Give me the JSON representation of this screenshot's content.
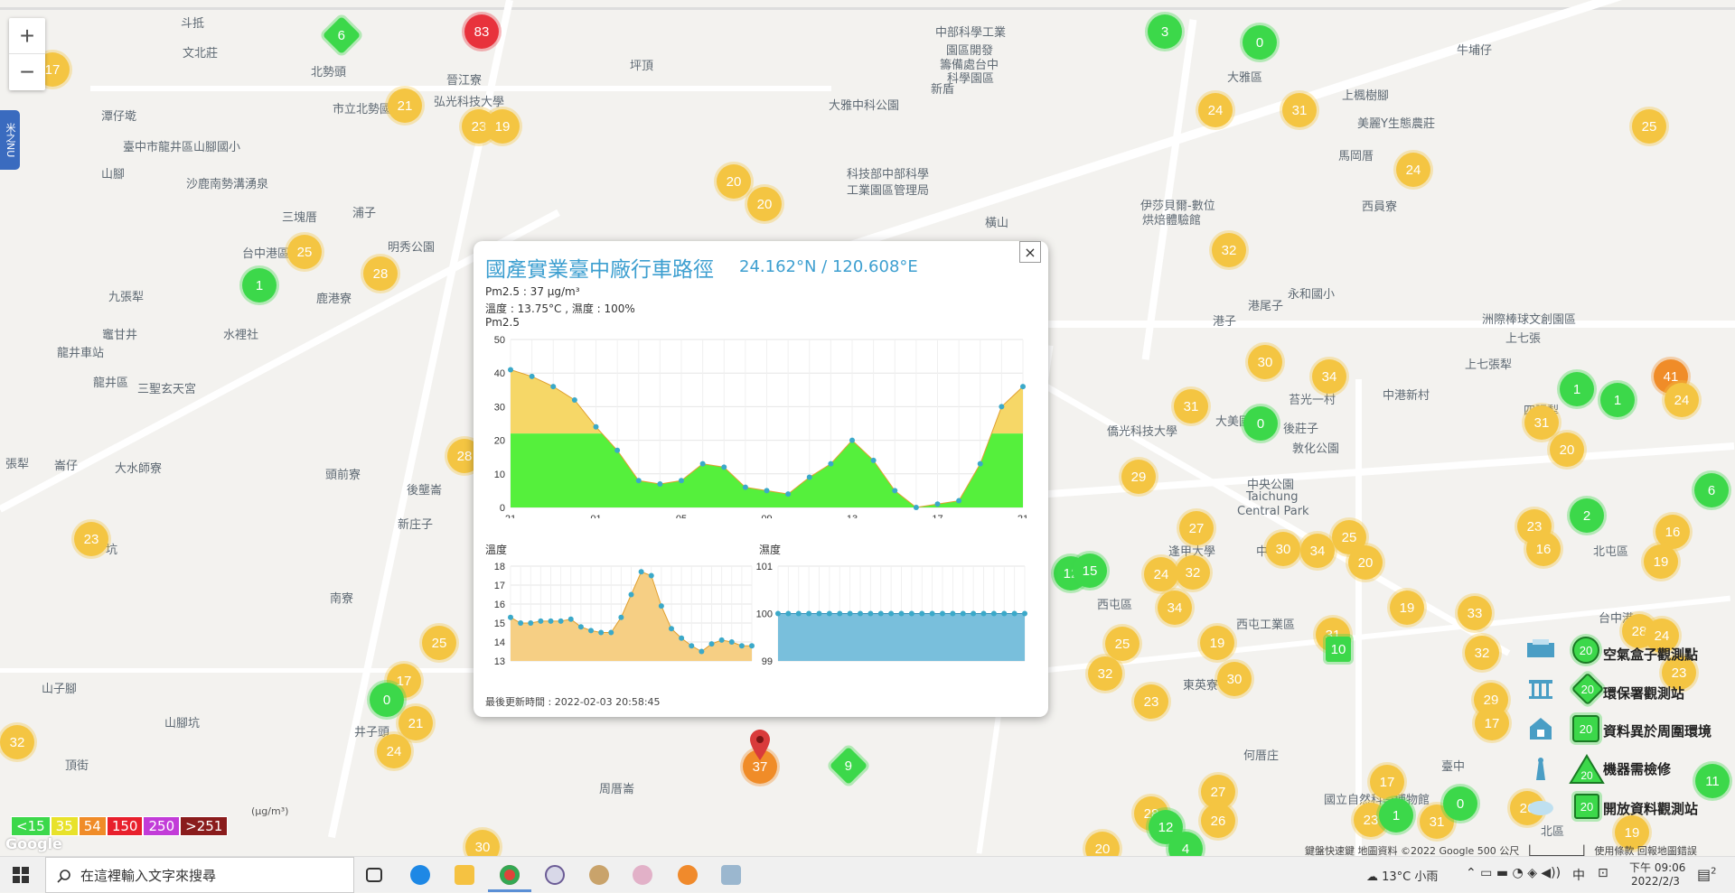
{
  "map": {
    "place_labels": [
      {
        "t": "斗抵",
        "x": 200,
        "y": 15
      },
      {
        "t": "文北莊",
        "x": 202,
        "y": 48
      },
      {
        "t": "北勢頭",
        "x": 344,
        "y": 69
      },
      {
        "t": "晉江寮",
        "x": 494,
        "y": 78
      },
      {
        "t": "弘光科技大學",
        "x": 480,
        "y": 102
      },
      {
        "t": "市立北勢國小",
        "x": 368,
        "y": 110
      },
      {
        "t": "潭仔墘",
        "x": 112,
        "y": 118
      },
      {
        "t": "臺中市龍井區山腳國小",
        "x": 136,
        "y": 152
      },
      {
        "t": "山腳",
        "x": 112,
        "y": 182
      },
      {
        "t": "沙鹿南勢溝湧泉",
        "x": 206,
        "y": 193
      },
      {
        "t": "三塊厝",
        "x": 312,
        "y": 230
      },
      {
        "t": "浦子",
        "x": 390,
        "y": 225
      },
      {
        "t": "明秀公園",
        "x": 429,
        "y": 263
      },
      {
        "t": "台中港區",
        "x": 268,
        "y": 270
      },
      {
        "t": "鹿港寮",
        "x": 350,
        "y": 320
      },
      {
        "t": "九張犁",
        "x": 120,
        "y": 318
      },
      {
        "t": "水裡社",
        "x": 247,
        "y": 360
      },
      {
        "t": "竈甘井",
        "x": 113,
        "y": 360
      },
      {
        "t": "龍井車站",
        "x": 63,
        "y": 380
      },
      {
        "t": "三聖玄天宮",
        "x": 152,
        "y": 420
      },
      {
        "t": "龍井區",
        "x": 103,
        "y": 413
      },
      {
        "t": "張犁",
        "x": 6,
        "y": 503
      },
      {
        "t": "崙仔",
        "x": 60,
        "y": 505
      },
      {
        "t": "大水師寮",
        "x": 127,
        "y": 508
      },
      {
        "t": "頭前寮",
        "x": 360,
        "y": 515
      },
      {
        "t": "後壟崙",
        "x": 450,
        "y": 532
      },
      {
        "t": "新庄子",
        "x": 440,
        "y": 570
      },
      {
        "t": "溪",
        "x": 95,
        "y": 582
      },
      {
        "t": "坑",
        "x": 117,
        "y": 598
      },
      {
        "t": "南寮",
        "x": 365,
        "y": 652
      },
      {
        "t": "山子腳",
        "x": 46,
        "y": 752
      },
      {
        "t": "山腳坑",
        "x": 182,
        "y": 790
      },
      {
        "t": "井子頭",
        "x": 392,
        "y": 800
      },
      {
        "t": "頂街",
        "x": 72,
        "y": 837
      },
      {
        "t": "周厝崙",
        "x": 663,
        "y": 863
      },
      {
        "t": "坪頂",
        "x": 697,
        "y": 62
      },
      {
        "t": "新盾",
        "x": 1030,
        "y": 88
      },
      {
        "t": "大雅中科公園",
        "x": 917,
        "y": 106
      },
      {
        "t": "科技部中部科學",
        "x": 937,
        "y": 182
      },
      {
        "t": "工業園區管理局",
        "x": 937,
        "y": 200
      },
      {
        "t": "中部科學工業",
        "x": 1035,
        "y": 25
      },
      {
        "t": "園區開發",
        "x": 1047,
        "y": 45
      },
      {
        "t": "籌備處台中",
        "x": 1040,
        "y": 61
      },
      {
        "t": "科學園區",
        "x": 1048,
        "y": 76
      },
      {
        "t": "橫山",
        "x": 1090,
        "y": 236
      },
      {
        "t": "伊莎貝爾-數位",
        "x": 1262,
        "y": 217
      },
      {
        "t": "烘焙體驗館",
        "x": 1264,
        "y": 233
      },
      {
        "t": "大雅區",
        "x": 1358,
        "y": 75
      },
      {
        "t": "上楓樹腳",
        "x": 1485,
        "y": 95
      },
      {
        "t": "牛埔仔",
        "x": 1612,
        "y": 45
      },
      {
        "t": "美麗Y生態農莊",
        "x": 1502,
        "y": 126
      },
      {
        "t": "馬岡厝",
        "x": 1481,
        "y": 162
      },
      {
        "t": "西員寮",
        "x": 1507,
        "y": 218
      },
      {
        "t": "永和國小",
        "x": 1425,
        "y": 315
      },
      {
        "t": "港尾子",
        "x": 1381,
        "y": 328
      },
      {
        "t": "港子",
        "x": 1342,
        "y": 345
      },
      {
        "t": "上七張",
        "x": 1666,
        "y": 364
      },
      {
        "t": "上七張犁",
        "x": 1621,
        "y": 393
      },
      {
        "t": "洲際棒球文創園區",
        "x": 1640,
        "y": 343
      },
      {
        "t": "中港新村",
        "x": 1530,
        "y": 427
      },
      {
        "t": "四張犁",
        "x": 1686,
        "y": 444
      },
      {
        "t": "苔光一村",
        "x": 1426,
        "y": 432
      },
      {
        "t": "僑光科技大學",
        "x": 1225,
        "y": 467
      },
      {
        "t": "大美國小",
        "x": 1345,
        "y": 456
      },
      {
        "t": "後莊子",
        "x": 1420,
        "y": 464
      },
      {
        "t": "敦化公園",
        "x": 1430,
        "y": 486
      },
      {
        "t": "中央公園",
        "x": 1380,
        "y": 526
      },
      {
        "t": "Taichung",
        "x": 1379,
        "y": 543
      },
      {
        "t": "Central Park",
        "x": 1369,
        "y": 559
      },
      {
        "t": "逢甲大學",
        "x": 1293,
        "y": 600
      },
      {
        "t": "西屯區",
        "x": 1214,
        "y": 659
      },
      {
        "t": "西屯工業區",
        "x": 1368,
        "y": 681
      },
      {
        "t": "東英寮",
        "x": 1309,
        "y": 748
      },
      {
        "t": "中科",
        "x": 1390,
        "y": 600
      },
      {
        "t": "北屯區",
        "x": 1763,
        "y": 600
      },
      {
        "t": "台中港",
        "x": 1769,
        "y": 674
      },
      {
        "t": "臺中",
        "x": 1595,
        "y": 838
      },
      {
        "t": "何厝庄",
        "x": 1376,
        "y": 826
      },
      {
        "t": "國立自然科學博物館",
        "x": 1465,
        "y": 875
      },
      {
        "t": "北區",
        "x": 1705,
        "y": 910
      }
    ]
  },
  "zoom": {
    "in": "+",
    "out": "−"
  },
  "side_tab": {
    "label": "米之NU"
  },
  "markers": [
    {
      "v": "6",
      "c": "g",
      "s": "dia",
      "x": 378,
      "y": 39
    },
    {
      "v": "83",
      "c": "r",
      "x": 533,
      "y": 35
    },
    {
      "v": "17",
      "c": "y",
      "x": 58,
      "y": 77
    },
    {
      "v": "21",
      "c": "y",
      "x": 448,
      "y": 117
    },
    {
      "v": "23",
      "c": "y",
      "x": 530,
      "y": 140
    },
    {
      "v": "19",
      "c": "y",
      "x": 556,
      "y": 140
    },
    {
      "v": "1",
      "c": "g",
      "x": 287,
      "y": 316
    },
    {
      "v": "25",
      "c": "y",
      "x": 337,
      "y": 279
    },
    {
      "v": "28",
      "c": "y",
      "x": 421,
      "y": 303
    },
    {
      "v": "20",
      "c": "y",
      "x": 812,
      "y": 201
    },
    {
      "v": "20",
      "c": "y",
      "x": 846,
      "y": 226
    },
    {
      "v": "28",
      "c": "y",
      "x": 514,
      "y": 505
    },
    {
      "v": "23",
      "c": "y",
      "x": 101,
      "y": 597
    },
    {
      "v": "25",
      "c": "y",
      "x": 486,
      "y": 712
    },
    {
      "v": "17",
      "c": "y",
      "x": 447,
      "y": 754
    },
    {
      "v": "0",
      "c": "g",
      "x": 428,
      "y": 775
    },
    {
      "v": "21",
      "c": "y",
      "x": 460,
      "y": 801
    },
    {
      "v": "24",
      "c": "y",
      "x": 436,
      "y": 832
    },
    {
      "v": "32",
      "c": "y",
      "x": 19,
      "y": 822
    },
    {
      "v": "30",
      "c": "y",
      "x": 534,
      "y": 938
    },
    {
      "v": "9",
      "c": "g",
      "s": "dia",
      "x": 939,
      "y": 848
    },
    {
      "v": "3",
      "c": "g",
      "x": 1289,
      "y": 35
    },
    {
      "v": "0",
      "c": "g",
      "x": 1394,
      "y": 47
    },
    {
      "v": "24",
      "c": "y",
      "x": 1345,
      "y": 122
    },
    {
      "v": "31",
      "c": "y",
      "x": 1438,
      "y": 122
    },
    {
      "v": "25",
      "c": "y",
      "x": 1825,
      "y": 140
    },
    {
      "v": "24",
      "c": "y",
      "x": 1564,
      "y": 188
    },
    {
      "v": "32",
      "c": "y",
      "x": 1360,
      "y": 277
    },
    {
      "v": "30",
      "c": "y",
      "x": 1400,
      "y": 401
    },
    {
      "v": "34",
      "c": "y",
      "x": 1471,
      "y": 417
    },
    {
      "v": "31",
      "c": "y",
      "x": 1318,
      "y": 450
    },
    {
      "v": "0",
      "c": "g",
      "x": 1395,
      "y": 469
    },
    {
      "v": "29",
      "c": "y",
      "x": 1260,
      "y": 528
    },
    {
      "v": "27",
      "c": "y",
      "x": 1324,
      "y": 585
    },
    {
      "v": "30",
      "c": "y",
      "x": 1420,
      "y": 608
    },
    {
      "v": "34",
      "c": "y",
      "x": 1458,
      "y": 610
    },
    {
      "v": "25",
      "c": "y",
      "x": 1493,
      "y": 595
    },
    {
      "v": "20",
      "c": "y",
      "x": 1511,
      "y": 623
    },
    {
      "v": "12",
      "c": "g",
      "x": 1185,
      "y": 635
    },
    {
      "v": "15",
      "c": "g",
      "x": 1206,
      "y": 632
    },
    {
      "v": "24",
      "c": "y",
      "x": 1285,
      "y": 636
    },
    {
      "v": "32",
      "c": "y",
      "x": 1320,
      "y": 634
    },
    {
      "v": "34",
      "c": "y",
      "x": 1300,
      "y": 673
    },
    {
      "v": "19",
      "c": "y",
      "x": 1557,
      "y": 673
    },
    {
      "v": "33",
      "c": "y",
      "x": 1632,
      "y": 679
    },
    {
      "v": "31",
      "c": "y",
      "x": 1475,
      "y": 703
    },
    {
      "v": "10",
      "c": "g",
      "s": "sq",
      "x": 1481,
      "y": 719
    },
    {
      "v": "19",
      "c": "y",
      "x": 1347,
      "y": 712
    },
    {
      "v": "25",
      "c": "y",
      "x": 1242,
      "y": 713
    },
    {
      "v": "32",
      "c": "y",
      "x": 1223,
      "y": 746
    },
    {
      "v": "30",
      "c": "y",
      "x": 1366,
      "y": 752
    },
    {
      "v": "23",
      "c": "y",
      "x": 1274,
      "y": 777
    },
    {
      "v": "32",
      "c": "y",
      "x": 1640,
      "y": 723
    },
    {
      "v": "29",
      "c": "y",
      "x": 1650,
      "y": 775
    },
    {
      "v": "17",
      "c": "y",
      "x": 1651,
      "y": 801
    },
    {
      "v": "27",
      "c": "y",
      "x": 1348,
      "y": 877
    },
    {
      "v": "26",
      "c": "y",
      "x": 1348,
      "y": 909
    },
    {
      "v": "28",
      "c": "y",
      "x": 1274,
      "y": 901
    },
    {
      "v": "12",
      "c": "g",
      "x": 1290,
      "y": 916
    },
    {
      "v": "4",
      "c": "g",
      "x": 1312,
      "y": 940
    },
    {
      "v": "20",
      "c": "y",
      "x": 1220,
      "y": 940
    },
    {
      "v": "17",
      "c": "y",
      "x": 1535,
      "y": 866
    },
    {
      "v": "23",
      "c": "y",
      "x": 1517,
      "y": 908
    },
    {
      "v": "1",
      "c": "g",
      "x": 1545,
      "y": 903
    },
    {
      "v": "31",
      "c": "y",
      "x": 1590,
      "y": 910
    },
    {
      "v": "0",
      "c": "g",
      "x": 1616,
      "y": 890
    },
    {
      "v": "26",
      "c": "y",
      "x": 1690,
      "y": 895
    },
    {
      "v": "19",
      "c": "y",
      "x": 1806,
      "y": 922
    },
    {
      "v": "11",
      "c": "g",
      "x": 1895,
      "y": 865
    },
    {
      "v": "1",
      "c": "g",
      "x": 1745,
      "y": 431
    },
    {
      "v": "1",
      "c": "g",
      "x": 1790,
      "y": 443
    },
    {
      "v": "31",
      "c": "y",
      "x": 1706,
      "y": 468
    },
    {
      "v": "20",
      "c": "y",
      "x": 1734,
      "y": 498
    },
    {
      "v": "41",
      "c": "o",
      "x": 1849,
      "y": 417
    },
    {
      "v": "24",
      "c": "y",
      "x": 1861,
      "y": 443
    },
    {
      "v": "6",
      "c": "g",
      "x": 1894,
      "y": 543
    },
    {
      "v": "2",
      "c": "g",
      "x": 1756,
      "y": 571
    },
    {
      "v": "23",
      "c": "y",
      "x": 1698,
      "y": 583
    },
    {
      "v": "16",
      "c": "y",
      "x": 1708,
      "y": 608
    },
    {
      "v": "16",
      "c": "y",
      "x": 1851,
      "y": 589
    },
    {
      "v": "19",
      "c": "y",
      "x": 1838,
      "y": 622
    },
    {
      "v": "28",
      "c": "y",
      "x": 1814,
      "y": 699
    },
    {
      "v": "24",
      "c": "y",
      "x": 1839,
      "y": 704
    },
    {
      "v": "23",
      "c": "y",
      "x": 1858,
      "y": 745
    },
    {
      "v": "37",
      "c": "o",
      "x": 841,
      "y": 849
    }
  ],
  "popup": {
    "title": "國產實業臺中廠行車路徑",
    "coord": "24.162°N / 120.608°E",
    "pm25_line": "Pm2.5 : 37 μg/m³",
    "weather_line": "溫度 : 13.75°C , 濕度 : 100%",
    "chart_heading": "Pm2.5",
    "temp_heading": "溫度",
    "hum_heading": "濕度",
    "updated": "最後更新時間 : 2022-02-03 20:58:45",
    "close": "×"
  },
  "chart_data": [
    {
      "type": "area",
      "title": "Pm2.5",
      "x_ticks": [
        "21",
        "01",
        "05",
        "09",
        "13",
        "17",
        "21"
      ],
      "ylim": [
        0,
        50
      ],
      "y_ticks": [
        0,
        10,
        20,
        30,
        40,
        50
      ],
      "values": [
        41,
        39,
        36,
        32,
        24,
        17,
        8,
        7,
        8,
        13,
        12,
        6,
        5,
        4,
        9,
        13,
        20,
        14,
        5,
        0,
        1,
        2,
        13,
        30,
        36
      ],
      "threshold": 22,
      "colors": {
        "low": "#55f03c",
        "high": "#f6d767",
        "points": "#3ba9c9"
      }
    },
    {
      "type": "area",
      "title": "溫度",
      "ylim": [
        13,
        18
      ],
      "y_ticks": [
        13,
        14,
        15,
        16,
        17,
        18
      ],
      "values": [
        15.3,
        15,
        15,
        15.1,
        15.1,
        15.1,
        15.2,
        14.8,
        14.6,
        14.5,
        14.5,
        15.3,
        16.5,
        17.7,
        17.5,
        15.9,
        14.7,
        14.2,
        13.8,
        13.5,
        13.9,
        14.1,
        14.0,
        13.8,
        13.8
      ],
      "color": "#f6cf84"
    },
    {
      "type": "area",
      "title": "濕度",
      "ylim": [
        99,
        101
      ],
      "y_ticks": [
        99,
        100,
        101
      ],
      "values": [
        100,
        100,
        100,
        100,
        100,
        100,
        100,
        100,
        100,
        100,
        100,
        100,
        100,
        100,
        100,
        100,
        100,
        100,
        100,
        100,
        100,
        100,
        100,
        100,
        100
      ],
      "color": "#79bfdc"
    }
  ],
  "legend_right": [
    {
      "label": "空氣盒子觀測點",
      "v": "20",
      "shape": "circle"
    },
    {
      "label": "環保署觀測站",
      "v": "20",
      "shape": "diamond"
    },
    {
      "label": "資料異於周圍環境",
      "v": "20",
      "shape": "house"
    },
    {
      "label": "機器需檢修",
      "v": "20",
      "shape": "triangle"
    },
    {
      "label": "開放資料觀測站",
      "v": "20",
      "shape": "square"
    }
  ],
  "scale_legend": [
    {
      "t": "<15",
      "c": "#3cd84a"
    },
    {
      "t": "35",
      "c": "#e8e22a"
    },
    {
      "t": "54",
      "c": "#f08c28"
    },
    {
      "t": "150",
      "c": "#e8202c"
    },
    {
      "t": "250",
      "c": "#c23cd8"
    },
    {
      "t": ">251",
      "c": "#8a1c1c"
    }
  ],
  "scale_units": "(μg/m³)",
  "google_logo": "Google",
  "attribution": "鍵盤快速鍵   地圖資料 ©2022 Google   500 公尺 ▕▁▁▁▁▁▁▁▏   使用條款   回報地圖錯誤",
  "taskbar": {
    "search_placeholder": "在這裡輸入文字來搜尋",
    "weather": "13°C  小雨",
    "ime": "中",
    "time": "下午 09:06",
    "date": "2022/2/3",
    "notif_count": "2"
  }
}
